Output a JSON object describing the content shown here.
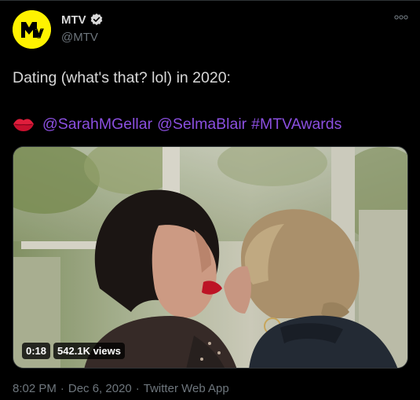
{
  "account": {
    "display_name": "MTV",
    "handle": "@MTV",
    "verified": true,
    "avatar_icon": "mtv-logo-icon",
    "avatar_color": "#fff200"
  },
  "tweet": {
    "text": "Dating (what's that? lol) in 2020:",
    "emoji_icon": "kiss-lips-icon",
    "mentions": [
      "@SarahMGellar",
      "@SelmaBlair"
    ],
    "hashtag": "#MTVAwards",
    "link_color": "#8b4fe0"
  },
  "video": {
    "duration": "0:18",
    "views": "542.1K views"
  },
  "meta": {
    "time": "8:02 PM",
    "separator": "·",
    "date": "Dec 6, 2020",
    "source": "Twitter Web App"
  },
  "more_icon": "more-options-icon"
}
